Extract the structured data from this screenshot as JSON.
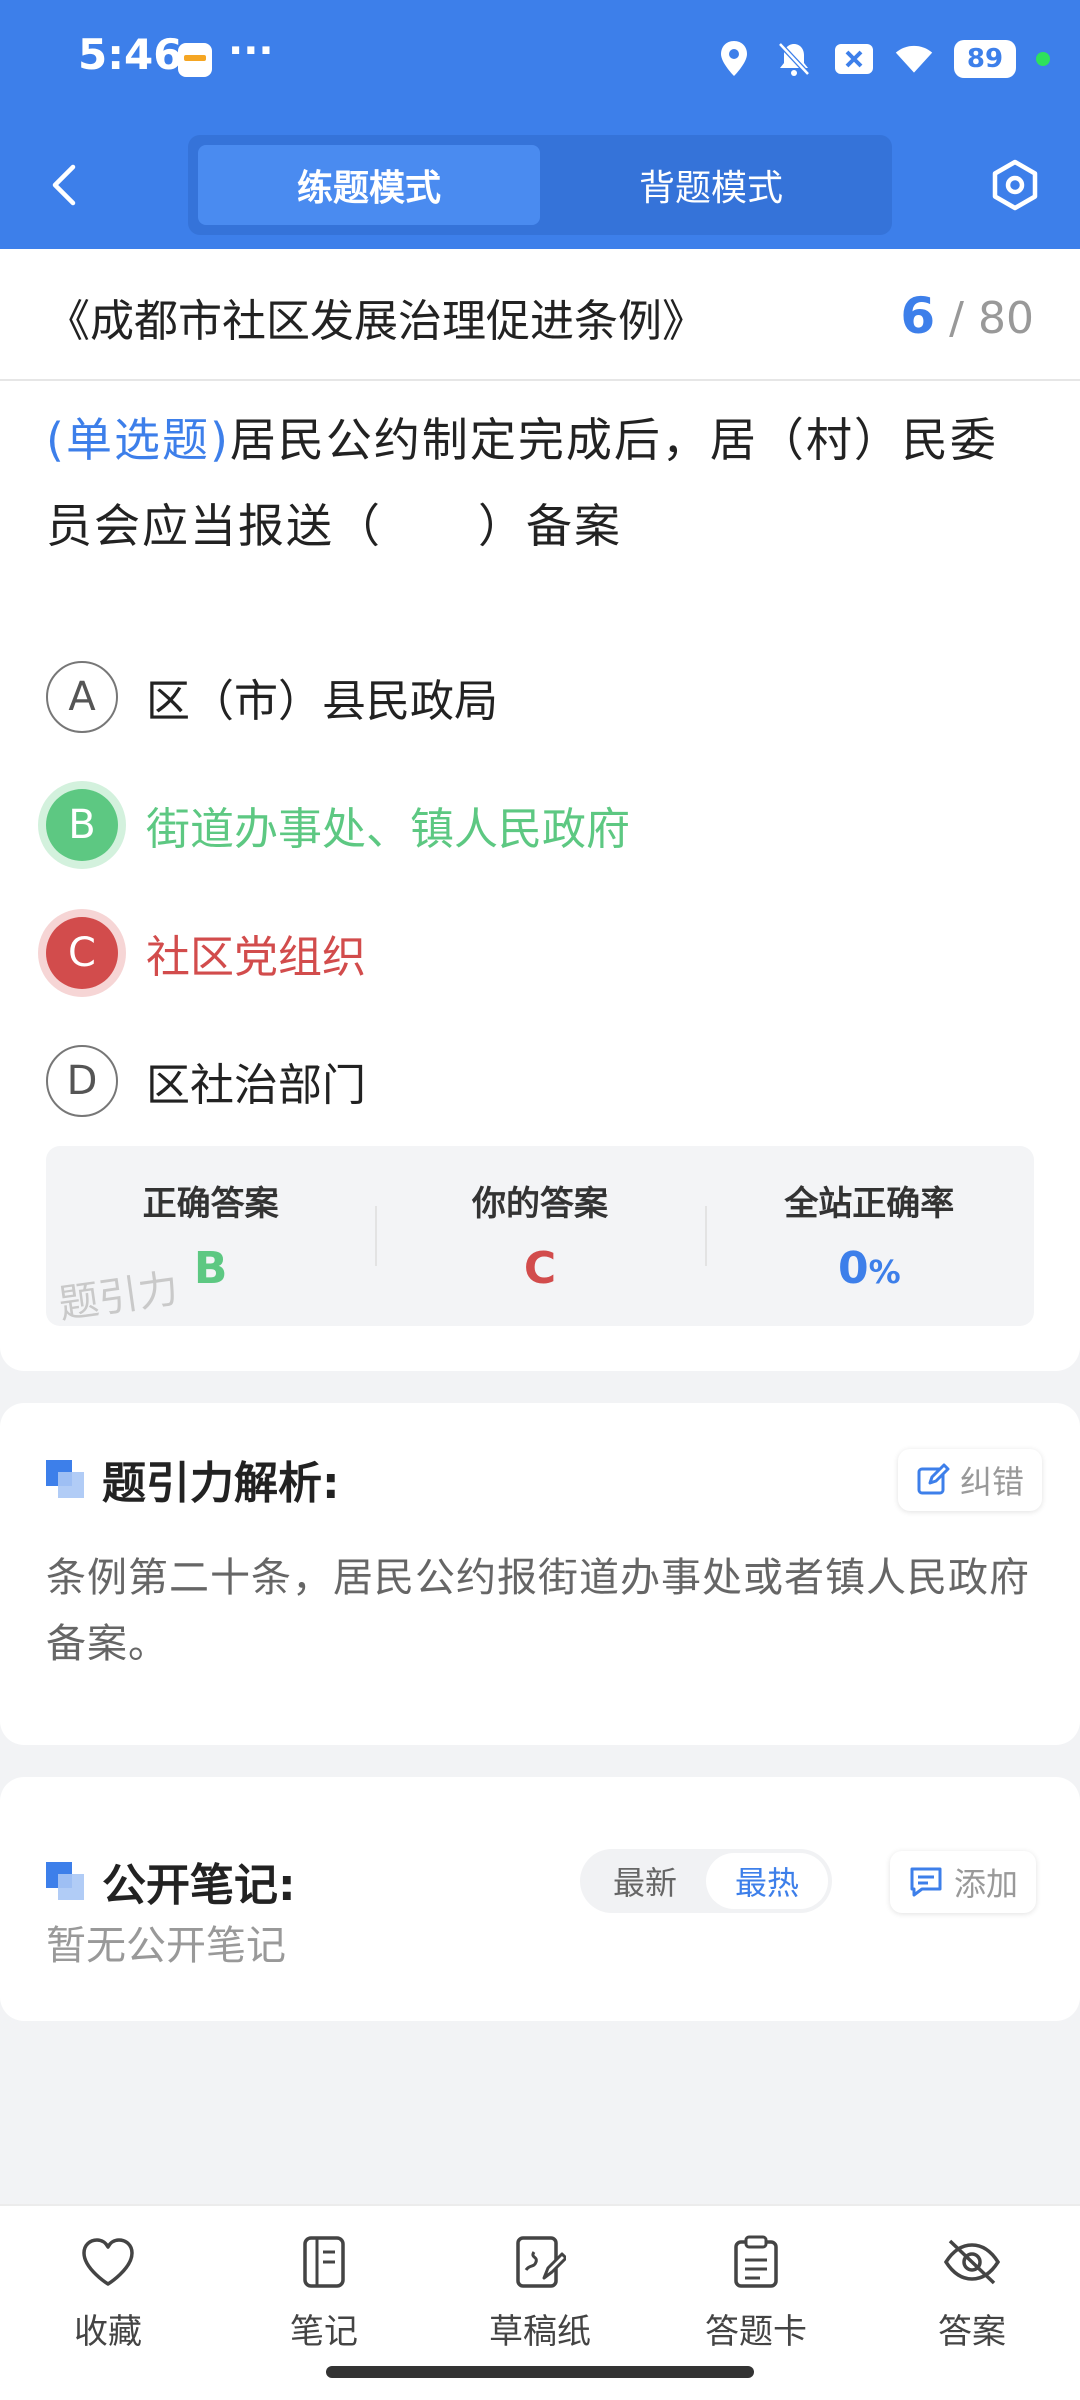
{
  "status_bar": {
    "time": "5:46",
    "more": "···",
    "battery": "89",
    "icons": [
      "location-icon",
      "bell-off-icon",
      "sim-x-icon",
      "wifi-icon",
      "battery-icon"
    ]
  },
  "header": {
    "modes": [
      {
        "label": "练题模式",
        "active": true
      },
      {
        "label": "背题模式",
        "active": false
      }
    ]
  },
  "document": {
    "title": "《成都市社区发展治理促进条例》",
    "current": "6",
    "separator": "/",
    "total": "80"
  },
  "question": {
    "type": "(单选题)",
    "text": "居民公约制定完成后，居（村）民委员会应当报送（　　）备案"
  },
  "options": [
    {
      "letter": "A",
      "text": "区（市）县民政局",
      "state": "normal"
    },
    {
      "letter": "B",
      "text": "街道办事处、镇人民政府",
      "state": "correct"
    },
    {
      "letter": "C",
      "text": "社区党组织",
      "state": "wrong"
    },
    {
      "letter": "D",
      "text": "区社治部门",
      "state": "normal"
    }
  ],
  "answer_summary": {
    "correct_label": "正确答案",
    "correct_value": "B",
    "yours_label": "你的答案",
    "yours_value": "C",
    "rate_label": "全站正确率",
    "rate_value": "0",
    "rate_unit": "%",
    "watermark": "题引力"
  },
  "analysis": {
    "title": "题引力解析:",
    "report_label": "纠错",
    "text": "条例第二十条，居民公约报街道办事处或者镇人民政府备案。"
  },
  "notes": {
    "title": "公开笔记:",
    "sort_latest": "最新",
    "sort_hot": "最热",
    "add_label": "添加",
    "empty_text": "暂无公开笔记"
  },
  "bottom_nav": [
    {
      "label": "收藏",
      "icon": "heart-icon"
    },
    {
      "label": "笔记",
      "icon": "notebook-icon"
    },
    {
      "label": "草稿纸",
      "icon": "draft-icon"
    },
    {
      "label": "答题卡",
      "icon": "answer-card-icon"
    },
    {
      "label": "答案",
      "icon": "eye-off-icon"
    }
  ],
  "colors": {
    "primary": "#3d7fea",
    "correct": "#5dc882",
    "wrong": "#d24c4c"
  }
}
